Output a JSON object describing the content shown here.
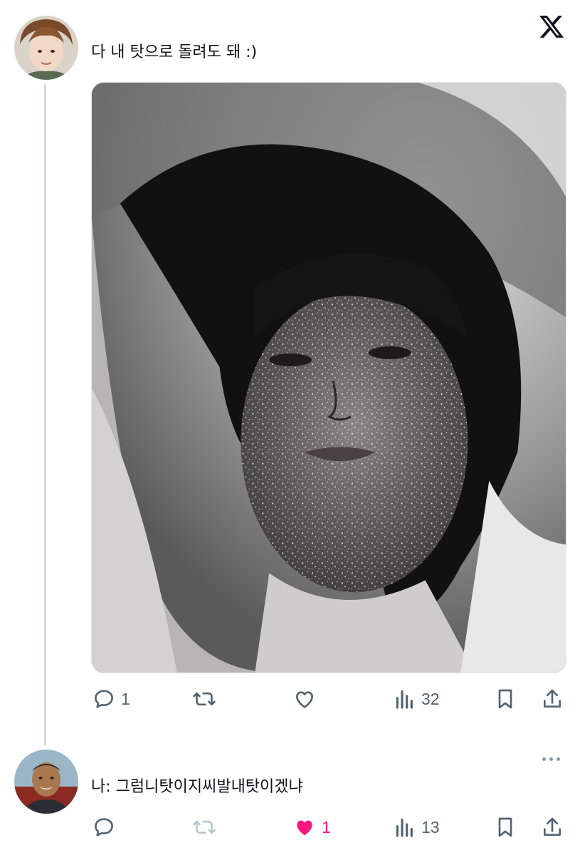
{
  "brand": {
    "logo": "X"
  },
  "tweets": [
    {
      "text": "다 내 탓으로 돌려도 돼 :)",
      "avatar_icon": "user-avatar-icon",
      "actions": {
        "reply_count": "1",
        "retweet_count": "",
        "like_count": "",
        "views_count": "32"
      },
      "liked": false
    },
    {
      "text": "나: 그럼니탓이지씨발내탓이겠냐",
      "avatar_icon": "user-avatar-icon",
      "actions": {
        "reply_count": "",
        "retweet_count": "",
        "like_count": "1",
        "views_count": "13"
      },
      "liked": true
    }
  ],
  "colors": {
    "text": "#0f1419",
    "secondary": "#536471",
    "like_active": "#f91880",
    "thread_line": "#cfd9de"
  }
}
